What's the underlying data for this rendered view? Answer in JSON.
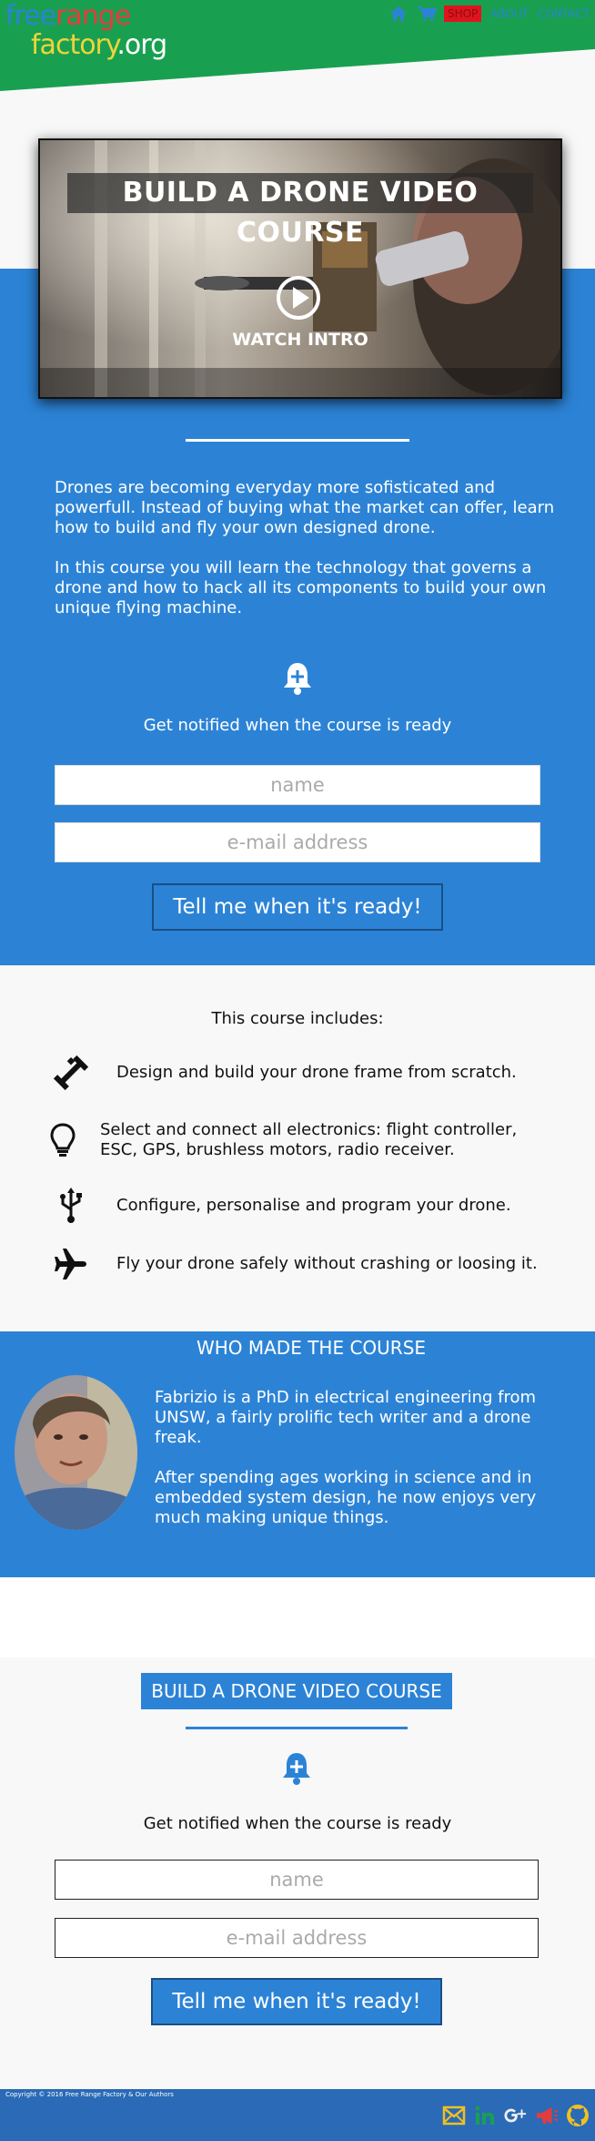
{
  "header": {
    "logo": {
      "part1": "free",
      "part2": "range",
      "part3": "factory",
      "part4": ".org"
    },
    "nav": {
      "home_icon": "home-icon",
      "cart_icon": "cart-icon",
      "shop": "SHOP",
      "about": "ABOUT",
      "contact": "CONTACT"
    }
  },
  "hero": {
    "video_title": "BUILD A DRONE VIDEO COURSE",
    "watch_label": "WATCH INTRO",
    "description": [
      "Drones are becoming everyday more sofisticated and powerfull. Instead of buying what the market can offer, learn how to build and fly your own designed drone.",
      "In this course you will learn the technology that governs a drone and how to hack all its components to build your own unique flying machine."
    ],
    "notify_text": "Get notified when the course is ready",
    "name_placeholder": "name",
    "email_placeholder": "e-mail address",
    "button_label": "Tell me when it's ready!"
  },
  "includes": {
    "title": "This course includes:",
    "items": [
      {
        "icon": "wrench-icon",
        "text": "Design and build your drone frame from scratch."
      },
      {
        "icon": "lightbulb-icon",
        "text": "Select and connect all electronics: flight controller, ESC, GPS, brushless motors, radio receiver."
      },
      {
        "icon": "usb-icon",
        "text": "Configure, personalise and program your drone."
      },
      {
        "icon": "plane-icon",
        "text": "Fly your drone safely without crashing or loosing it."
      }
    ]
  },
  "author": {
    "title": "WHO MADE THE COURSE",
    "bio": [
      "Fabrizio is a PhD in electrical engineering from UNSW, a fairly prolific tech writer and a drone freak.",
      "After spending ages working in science and in embedded system design, he now enjoys very much making unique things."
    ]
  },
  "cta2": {
    "title": "BUILD A DRONE VIDEO COURSE",
    "notify_text": "Get notified when the course is ready",
    "name_placeholder": "name",
    "email_placeholder": "e-mail address",
    "button_label": "Tell me when it's ready!"
  },
  "footer": {
    "copyright": "Copyright © 2016 Free Range Factory & Our Authors",
    "social": [
      "mail-icon",
      "linkedin-icon",
      "googleplus-icon",
      "megaphone-icon",
      "github-icon"
    ]
  },
  "colors": {
    "brand_green": "#18a050",
    "brand_blue": "#2c83d6",
    "footer_blue": "#2a6ab6",
    "shop_red": "#e0141e"
  }
}
